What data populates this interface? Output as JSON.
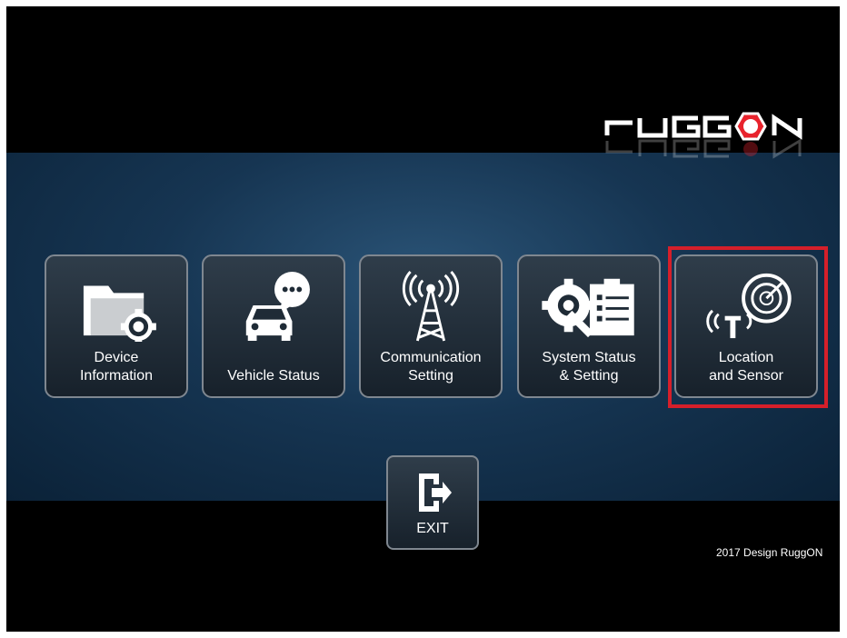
{
  "brand": {
    "logo_text": "RUGGON"
  },
  "menu": {
    "tiles": [
      {
        "id": "device-information",
        "label_lines": [
          "Device",
          "Information"
        ],
        "icon": "folder-gear-icon"
      },
      {
        "id": "vehicle-status",
        "label_lines": [
          "Vehicle Status"
        ],
        "icon": "car-chat-icon"
      },
      {
        "id": "communication-setting",
        "label_lines": [
          "Communication",
          "Setting"
        ],
        "icon": "antenna-tower-icon"
      },
      {
        "id": "system-status-setting",
        "label_lines": [
          "System Status",
          "& Setting"
        ],
        "icon": "gears-clipboard-icon"
      },
      {
        "id": "location-sensor",
        "label_lines": [
          "Location",
          "and Sensor"
        ],
        "icon": "radar-sensor-icon",
        "highlighted": true
      }
    ],
    "exit": {
      "label": "EXIT",
      "icon": "exit-icon"
    }
  },
  "footer": {
    "copyright": "2017 Design RuggON"
  },
  "colors": {
    "highlight": "#d51f2a",
    "band": "#1a3a58",
    "tile_border": "#7f8790"
  }
}
